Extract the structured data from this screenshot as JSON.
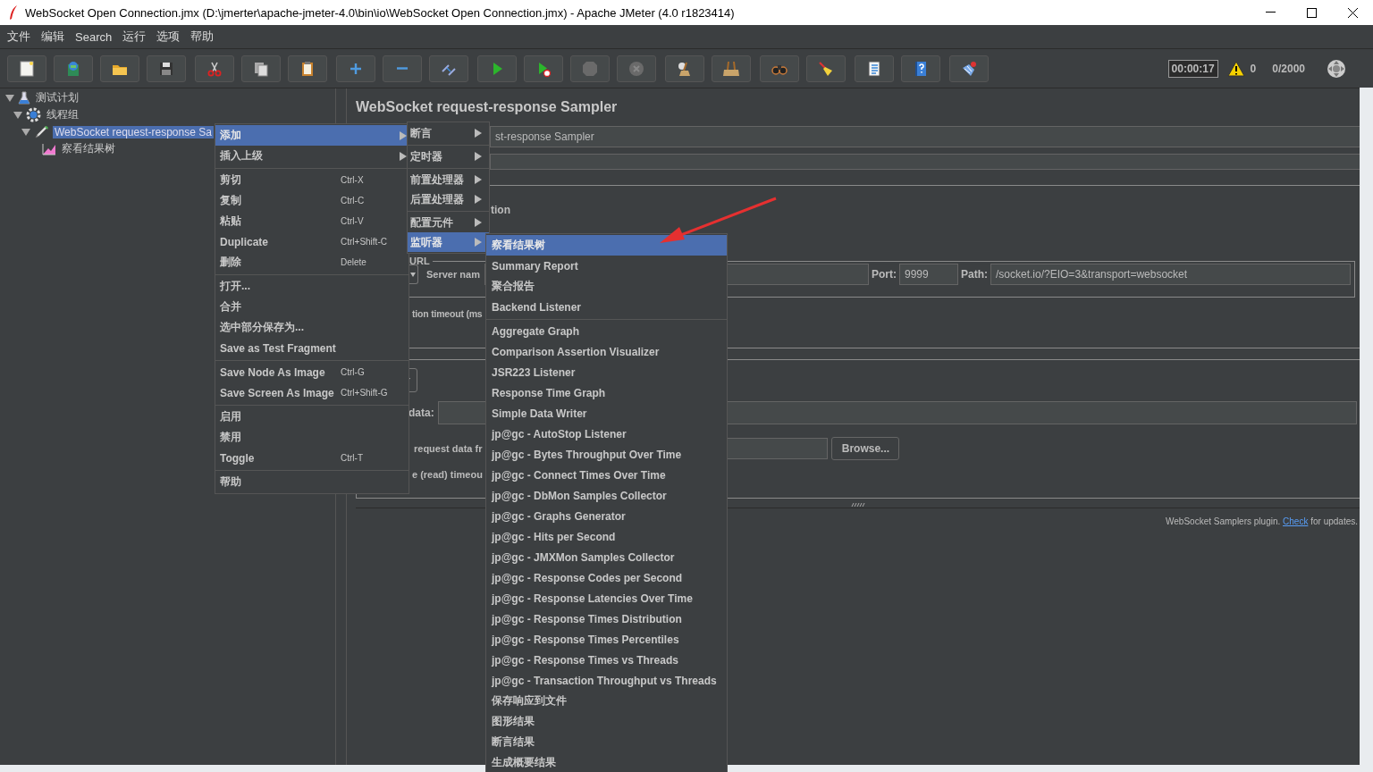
{
  "window": {
    "title": "WebSocket Open Connection.jmx (D:\\jmerter\\apache-jmeter-4.0\\bin\\io\\WebSocket Open Connection.jmx) - Apache JMeter (4.0 r1823414)"
  },
  "menu_bar": [
    "文件",
    "编辑",
    "Search",
    "运行",
    "选项",
    "帮助"
  ],
  "status": {
    "timer": "00:00:17",
    "warnings": "0",
    "threads": "0/2000"
  },
  "tree": [
    {
      "label": "测试计划",
      "kind": "plan",
      "expanded": true,
      "selected": false,
      "children": [
        {
          "label": "线程组",
          "kind": "thread_group",
          "expanded": true,
          "selected": false,
          "children": [
            {
              "label": "WebSocket request-response Sa",
              "kind": "sampler",
              "expanded": true,
              "selected": true,
              "children": [
                {
                  "label": "察看结果树",
                  "kind": "listener",
                  "selected": false
                }
              ]
            }
          ]
        }
      ]
    }
  ],
  "context_menu": {
    "groups": [
      [
        {
          "label": "添加",
          "submenu": true,
          "selected": true
        },
        {
          "label": "插入上级",
          "submenu": true,
          "selected": false
        }
      ],
      [
        {
          "label": "剪切",
          "shortcut": "Ctrl-X",
          "submenu": false,
          "selected": false
        },
        {
          "label": "复制",
          "shortcut": "Ctrl-C",
          "submenu": false,
          "selected": false
        },
        {
          "label": "粘贴",
          "shortcut": "Ctrl-V",
          "submenu": false,
          "selected": false
        },
        {
          "label": "Duplicate",
          "shortcut": "Ctrl+Shift-C",
          "submenu": false,
          "selected": false
        },
        {
          "label": "删除",
          "shortcut": "Delete",
          "submenu": false,
          "selected": false
        }
      ],
      [
        {
          "label": "打开...",
          "submenu": false,
          "selected": false
        },
        {
          "label": "合并",
          "submenu": false,
          "selected": false
        },
        {
          "label": "选中部分保存为...",
          "submenu": false,
          "selected": false
        },
        {
          "label": "Save as Test Fragment",
          "submenu": false,
          "selected": false
        }
      ],
      [
        {
          "label": "Save Node As Image",
          "shortcut": "Ctrl-G",
          "submenu": false,
          "selected": false
        },
        {
          "label": "Save Screen As Image",
          "shortcut": "Ctrl+Shift-G",
          "submenu": false,
          "selected": false
        }
      ],
      [
        {
          "label": "启用",
          "submenu": false,
          "selected": false
        },
        {
          "label": "禁用",
          "submenu": false,
          "selected": false
        },
        {
          "label": "Toggle",
          "shortcut": "Ctrl-T",
          "submenu": false,
          "selected": false
        }
      ],
      [
        {
          "label": "帮助",
          "submenu": false,
          "selected": false
        }
      ]
    ]
  },
  "add_submenu": {
    "groups": [
      [
        {
          "label": "断言",
          "submenu": true,
          "selected": false
        }
      ],
      [
        {
          "label": "定时器",
          "submenu": true,
          "selected": false
        }
      ],
      [
        {
          "label": "前置处理器",
          "submenu": true,
          "selected": false
        },
        {
          "label": "后置处理器",
          "submenu": true,
          "selected": false
        }
      ],
      [
        {
          "label": "配置元件",
          "submenu": true,
          "selected": false
        },
        {
          "label": "监听器",
          "submenu": true,
          "selected": true
        }
      ]
    ]
  },
  "listener_submenu": {
    "groups": [
      [
        {
          "label": "察看结果树",
          "submenu": false,
          "selected": true
        },
        {
          "label": "Summary Report",
          "submenu": false,
          "selected": false
        },
        {
          "label": "聚合报告",
          "submenu": false,
          "selected": false
        },
        {
          "label": "Backend Listener",
          "submenu": false,
          "selected": false
        }
      ],
      [
        {
          "label": "Aggregate Graph",
          "submenu": false,
          "selected": false
        },
        {
          "label": "Comparison Assertion Visualizer",
          "submenu": false,
          "selected": false
        },
        {
          "label": "JSR223 Listener",
          "submenu": false,
          "selected": false
        },
        {
          "label": "Response Time Graph",
          "submenu": false,
          "selected": false
        },
        {
          "label": "Simple Data Writer",
          "submenu": false,
          "selected": false
        },
        {
          "label": "jp@gc - AutoStop Listener",
          "submenu": false,
          "selected": false
        },
        {
          "label": "jp@gc - Bytes Throughput Over Time",
          "submenu": false,
          "selected": false
        },
        {
          "label": "jp@gc - Connect Times Over Time",
          "submenu": false,
          "selected": false
        },
        {
          "label": "jp@gc - DbMon Samples Collector",
          "submenu": false,
          "selected": false
        },
        {
          "label": "jp@gc - Graphs Generator",
          "submenu": false,
          "selected": false
        },
        {
          "label": "jp@gc - Hits per Second",
          "submenu": false,
          "selected": false
        },
        {
          "label": "jp@gc - JMXMon Samples Collector",
          "submenu": false,
          "selected": false
        },
        {
          "label": "jp@gc - Response Codes per Second",
          "submenu": false,
          "selected": false
        },
        {
          "label": "jp@gc - Response Latencies Over Time",
          "submenu": false,
          "selected": false
        },
        {
          "label": "jp@gc - Response Times Distribution",
          "submenu": false,
          "selected": false
        },
        {
          "label": "jp@gc - Response Times Percentiles",
          "submenu": false,
          "selected": false
        },
        {
          "label": "jp@gc - Response Times vs Threads",
          "submenu": false,
          "selected": false
        },
        {
          "label": "jp@gc - Transaction Throughput vs Threads",
          "submenu": false,
          "selected": false
        },
        {
          "label": "保存响应到文件",
          "submenu": false,
          "selected": false
        },
        {
          "label": "图形结果",
          "submenu": false,
          "selected": false
        },
        {
          "label": "断言结果",
          "submenu": false,
          "selected": false
        },
        {
          "label": "生成概要结果",
          "submenu": false,
          "selected": false
        }
      ]
    ]
  },
  "sampler": {
    "title": "WebSocket request-response Sampler",
    "name_value": "st-response Sampler",
    "connection_label": "tion",
    "url_legend": "URL",
    "server_label": "Server nam",
    "port_label": "Port:",
    "port_value": "9999",
    "path_label": "Path:",
    "path_value": "/socket.io/?EIO=3&transport=websocket",
    "timeout_label": "tion timeout (ms",
    "data_label": "data:",
    "file_label": "request data fr",
    "browse_button": "Browse...",
    "read_timeout_label": "e (read) timeou"
  },
  "footer": {
    "text_before": "WebSocket Samplers plugin.",
    "link": "Check",
    "text_after": "for updates."
  }
}
